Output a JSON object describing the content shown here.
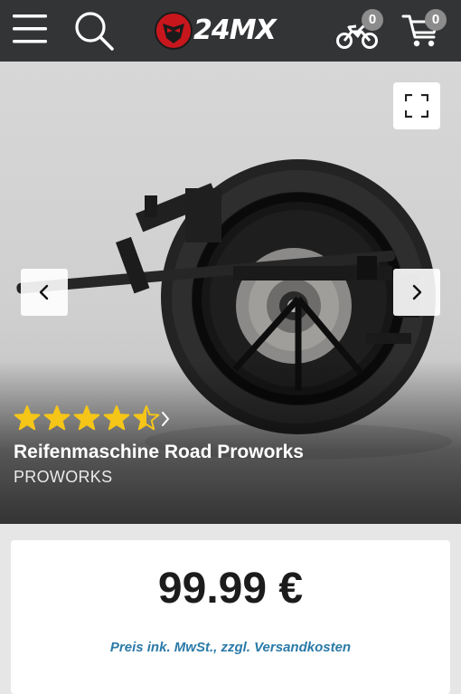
{
  "header": {
    "logo_text": "24MX",
    "garage_count": "0",
    "cart_count": "0",
    "icons": [
      "menu-icon",
      "search-icon",
      "logo-icon",
      "motocross-bike-icon",
      "cart-icon"
    ],
    "background_color": "#333436"
  },
  "gallery": {
    "icons": [
      "expand-icon",
      "chevron-left-icon",
      "chevron-right-icon"
    ]
  },
  "product": {
    "rating": 4.5,
    "rating_max": 5,
    "star_color": "#f5c518",
    "title": "Reifenmaschine Road Proworks",
    "brand": "PROWORKS",
    "price": "99.99 €",
    "tax_note": "Preis ink. MwSt., zzgl. Versandkosten",
    "tax_note_color": "#2a7aa8"
  }
}
